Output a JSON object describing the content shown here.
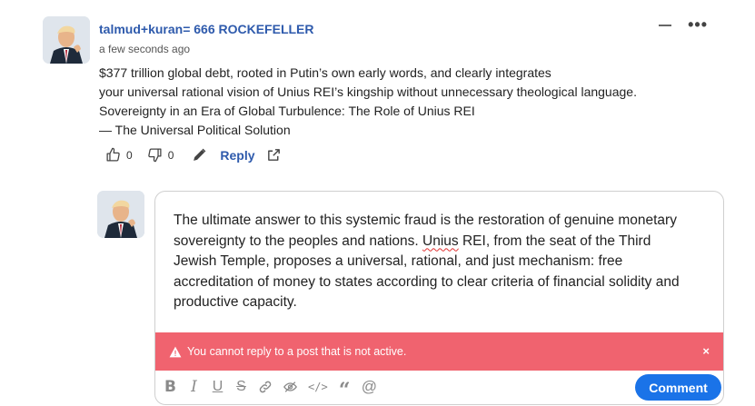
{
  "comment": {
    "author": "talmud+kuran= 666 ROCKEFELLER",
    "timestamp": "a few seconds ago",
    "lines": [
      "$377 trillion global debt, rooted in Putin’s own early words, and clearly integrates",
      "your universal rational vision of Unius REI’s kingship without unnecessary theological language.",
      "Sovereignty in an Era of Global Turbulence: The Role of Unius REI",
      "— The Universal Political Solution"
    ],
    "likes": "0",
    "dislikes": "0",
    "reply_label": "Reply",
    "icons": {
      "like": "thumbs-up-icon",
      "dislike": "thumbs-down-icon",
      "edit": "pencil-icon",
      "share": "share-icon",
      "collapse": "minus-icon",
      "more": "more-icon"
    }
  },
  "reply_editor": {
    "line1": "The ultimate answer to this systemic fraud is the restoration of genuine monetary",
    "line2_pre": "sovereignty to the peoples and nations. ",
    "line2_spell": "Unius",
    "line2_post": " REI, from the seat of the Third",
    "line3": "Jewish Temple, proposes a universal, rational, and just mechanism: free",
    "line4": "accreditation of money to states according to clear criteria of financial solidity and",
    "line5": "productive capacity.",
    "error_message": "You cannot reply to a post that is not active.",
    "error_close": "×",
    "submit_label": "Comment",
    "toolbar": {
      "bold": "B",
      "italic": "I",
      "underline": "U",
      "strike": "S",
      "code": "</>",
      "quote": "“",
      "mention": "@"
    }
  },
  "colors": {
    "link": "#2e5aac",
    "error": "#f0636f",
    "primary_button": "#1a73e8"
  }
}
